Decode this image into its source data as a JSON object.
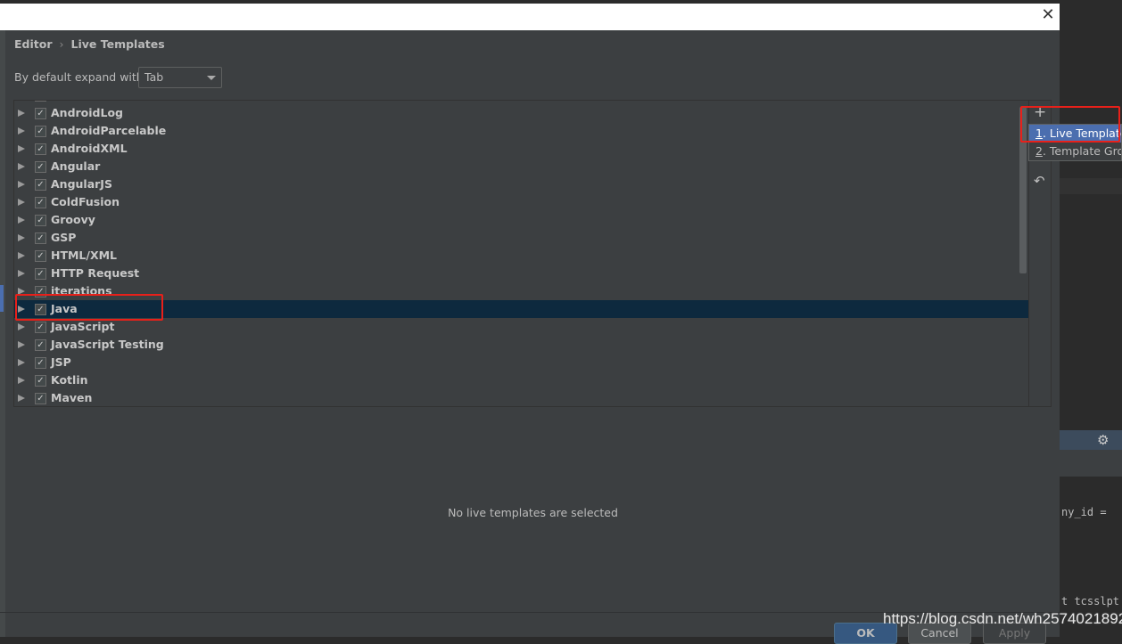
{
  "breadcrumb": {
    "parent": "Editor",
    "separator": "›",
    "current": "Live Templates"
  },
  "expand": {
    "label": "By default expand with",
    "value": "Tab"
  },
  "groups": [
    {
      "label": "AndroidLog",
      "checked": true
    },
    {
      "label": "AndroidParcelable",
      "checked": true
    },
    {
      "label": "AndroidXML",
      "checked": true
    },
    {
      "label": "Angular",
      "checked": true
    },
    {
      "label": "AngularJS",
      "checked": true
    },
    {
      "label": "ColdFusion",
      "checked": true
    },
    {
      "label": "Groovy",
      "checked": true
    },
    {
      "label": "GSP",
      "checked": true
    },
    {
      "label": "HTML/XML",
      "checked": true
    },
    {
      "label": "HTTP Request",
      "checked": true
    },
    {
      "label": "iterations",
      "checked": true
    },
    {
      "label": "Java",
      "checked": true,
      "selected": true
    },
    {
      "label": "JavaScript",
      "checked": true
    },
    {
      "label": "JavaScript Testing",
      "checked": true
    },
    {
      "label": "JSP",
      "checked": true
    },
    {
      "label": "Kotlin",
      "checked": true
    },
    {
      "label": "Maven",
      "checked": true
    }
  ],
  "toolbar": {
    "add_icon": "+",
    "revert_icon": "↶"
  },
  "popup": {
    "items": [
      {
        "num": "1",
        "label": ". Live Template"
      },
      {
        "num": "2",
        "label": ". Template Group..."
      }
    ]
  },
  "empty_text": "No live templates are selected",
  "buttons": {
    "ok": "OK",
    "cancel": "Cancel",
    "apply": "Apply"
  },
  "background_code": {
    "line1": "ny_id =",
    "line2": "t tcsslpt"
  },
  "watermark": "https://blog.csdn.net/wh2574021892",
  "colors": {
    "selection": "#0d293e",
    "popup_highlight": "#4b6eaf",
    "annotation": "#e8201a"
  }
}
